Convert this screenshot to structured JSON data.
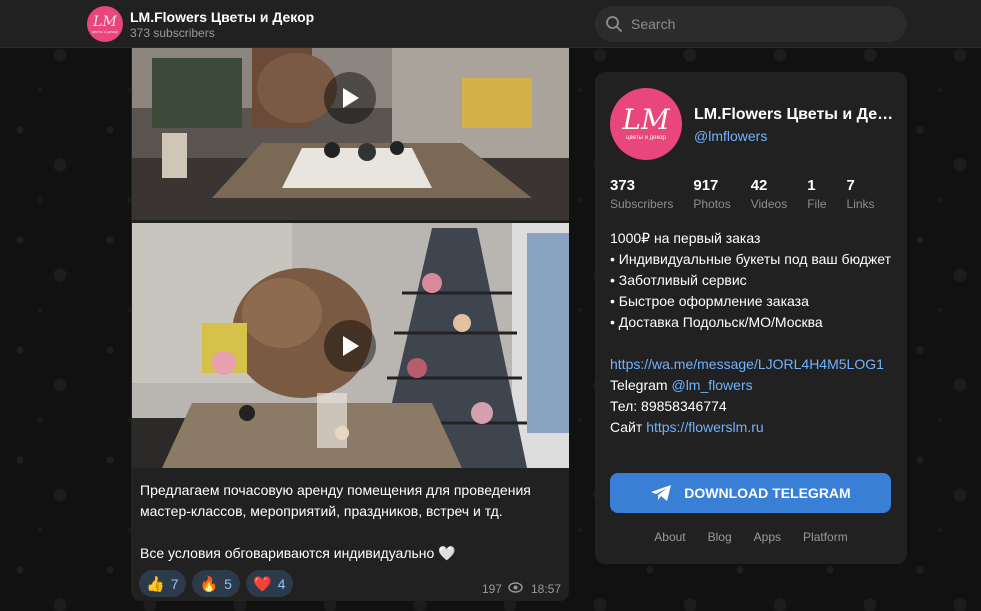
{
  "header": {
    "channel_title": "LM.Flowers Цветы и Декор",
    "subscribers_text": "373 subscribers",
    "logo_text": "LM",
    "logo_subtext": "цветы и декор",
    "search_placeholder": "Search"
  },
  "post": {
    "text_line1": "Предлагаем почасовую аренду помещения для проведения мастер-классов, мероприятий, праздников, встреч и тд.",
    "text_line2": "Все условия обговариваются индивидуально 🤍",
    "reactions": [
      {
        "emoji": "👍",
        "count": "7"
      },
      {
        "emoji": "🔥",
        "count": "5"
      },
      {
        "emoji": "❤️",
        "count": "4"
      }
    ],
    "views": "197",
    "time": "18:57"
  },
  "card": {
    "title": "LM.Flowers Цветы и Декор",
    "handle": "@lmflowers",
    "logo_text": "LM",
    "logo_subtext": "цветы и декор",
    "stats": [
      {
        "value": "373",
        "label": "Subscribers"
      },
      {
        "value": "917",
        "label": "Photos"
      },
      {
        "value": "42",
        "label": "Videos"
      },
      {
        "value": "1",
        "label": "File"
      },
      {
        "value": "7",
        "label": "Links"
      }
    ],
    "desc_lines": [
      "1000₽ на первый заказ",
      "• Индивидуальные букеты под ваш бюджет",
      "• Заботливый сервис",
      "• Быстрое оформление заказа",
      "• Доставка Подольск/МО/Москва"
    ],
    "wa_link": "https://wa.me/message/LJORL4H4M5LOG1",
    "telegram_label": "Telegram",
    "telegram_link": "@lm_flowers",
    "phone": "Тел: 89858346774",
    "site_label": "Сайт",
    "site_link": "https://flowerslm.ru",
    "download_label": "DOWNLOAD TELEGRAM",
    "footer_links": [
      "About",
      "Blog",
      "Apps",
      "Platform"
    ]
  },
  "colors": {
    "accent": "#3a7fd6",
    "link": "#71b2ff",
    "brand_pink": "#e8467c",
    "panel": "#212121"
  },
  "icons": [
    "search-icon",
    "play-icon",
    "eye-icon",
    "telegram-plane-icon"
  ]
}
